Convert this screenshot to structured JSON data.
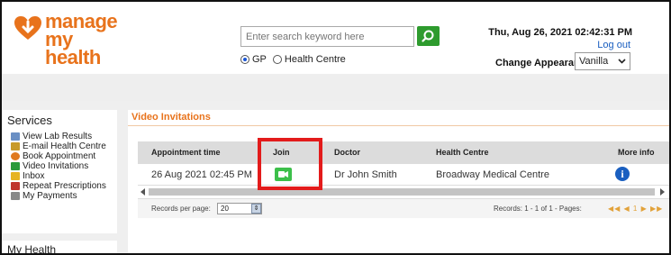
{
  "header": {
    "logo_line1": "manage",
    "logo_line2": "my health",
    "search_placeholder": "Enter search keyword here",
    "radio_gp": "GP",
    "radio_health_centre": "Health Centre",
    "datetime": "Thu, Aug 26, 2021 02:42:31 PM",
    "logout": "Log out",
    "change_appearance_label": "Change Appearance",
    "appearance_value": "Vanilla"
  },
  "sidebar": {
    "title": "Services",
    "items": [
      {
        "label": "View Lab Results",
        "icon": "lab-results-icon",
        "color": "#6a8fc4"
      },
      {
        "label": "E-mail Health Centre",
        "icon": "email-icon",
        "color": "#c89a2a"
      },
      {
        "label": "Book Appointment",
        "icon": "clock-icon",
        "color": "#e07a1e"
      },
      {
        "label": "Video Invitations",
        "icon": "video-icon",
        "color": "#2a9a3a"
      },
      {
        "label": "Inbox",
        "icon": "inbox-icon",
        "color": "#e6b422"
      },
      {
        "label": "Repeat Prescriptions",
        "icon": "prescription-icon",
        "color": "#c0362c"
      },
      {
        "label": "My Payments",
        "icon": "payments-icon",
        "color": "#888888"
      }
    ],
    "section2_title": "My Health"
  },
  "main": {
    "tab_label": "Video Invitations",
    "columns": [
      "Appointment time",
      "Join",
      "Doctor",
      "Health Centre",
      "More info"
    ],
    "rows": [
      {
        "appointment_time": "26 Aug 2021 02:45 PM",
        "doctor": "Dr John Smith",
        "health_centre": "Broadway Medical Centre"
      }
    ],
    "records_per_page_label": "Records per page:",
    "records_per_page_value": "20",
    "records_summary": "Records: 1 - 1 of 1 - Pages:",
    "pager_nav": "◀◀ ◀ 1 ▶ ▶▶"
  },
  "colors": {
    "brand_orange": "#e8731c",
    "join_green": "#3cbf4a",
    "highlight_red": "#e31b1b",
    "link_blue": "#1a5fc0"
  }
}
